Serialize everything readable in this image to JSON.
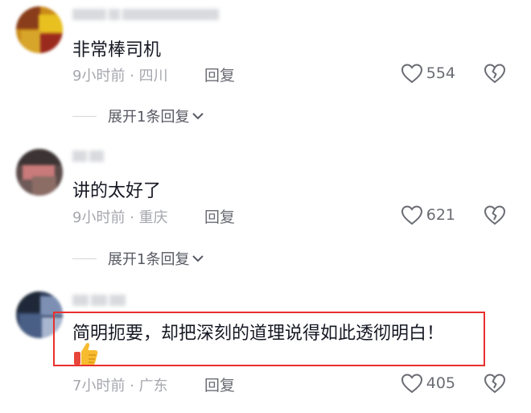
{
  "comments": [
    {
      "text": "非常棒司机",
      "time_location": "9小时前 · 四川",
      "reply_label": "回复",
      "likes": "554",
      "expand_label": "展开1条回复"
    },
    {
      "text": "讲的太好了",
      "time_location": "9小时前 · 重庆",
      "reply_label": "回复",
      "likes": "621",
      "expand_label": "展开1条回复"
    },
    {
      "text": "简明扼要，却把深刻的道理说得如此透彻明白！",
      "time_location": "7小时前 · 广东",
      "reply_label": "回复",
      "likes": "405",
      "emoji": "thumbs-up-emoji"
    }
  ],
  "icons": {
    "like": "heart-outline-icon",
    "dislike": "broken-heart-icon",
    "expand": "chevron-down-icon"
  },
  "colors": {
    "text": "#161823",
    "meta": "#a5a7ad",
    "action": "#6a6c73",
    "highlight": "#e8302d"
  }
}
